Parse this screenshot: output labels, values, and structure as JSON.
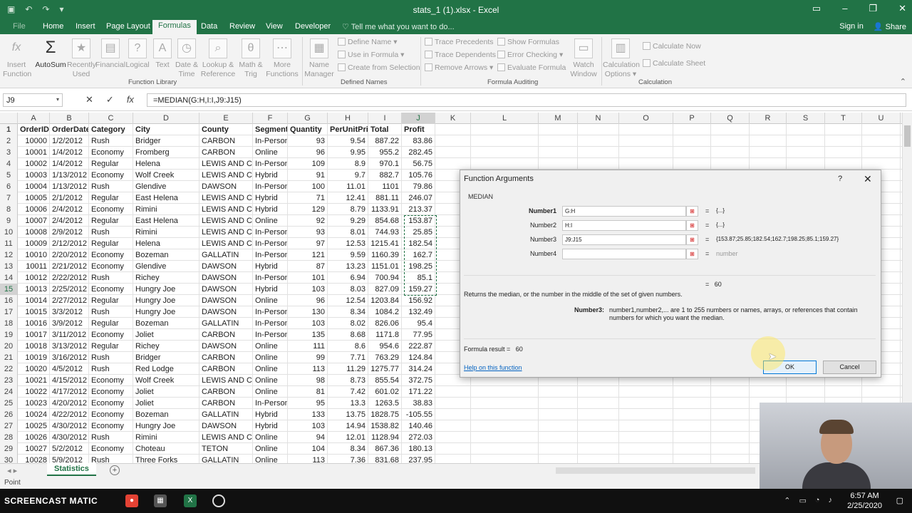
{
  "window": {
    "title": "stats_1 (1).xlsx - Excel"
  },
  "tabs": [
    "Home",
    "Insert",
    "Page Layout",
    "Formulas",
    "Data",
    "Review",
    "View",
    "Developer"
  ],
  "active_tab": "Formulas",
  "tell_me": "Tell me what you want to do...",
  "sign_in": "Sign in",
  "share": "Share",
  "ribbon": {
    "insert_function": [
      "Insert",
      "Function"
    ],
    "autosum": "AutoSum",
    "recently_used": [
      "Recently",
      "Used"
    ],
    "financial": "Financial",
    "logical": "Logical",
    "text": "Text",
    "date_time": [
      "Date &",
      "Time"
    ],
    "lookup": [
      "Lookup &",
      "Reference"
    ],
    "math": [
      "Math &",
      "Trig"
    ],
    "more": [
      "More",
      "Functions"
    ],
    "name_manager": [
      "Name",
      "Manager"
    ],
    "define_name": "Define Name",
    "use_in_formula": "Use in Formula",
    "create_from_selection": "Create from Selection",
    "trace_precedents": "Trace Precedents",
    "trace_dependents": "Trace Dependents",
    "remove_arrows": "Remove Arrows",
    "show_formulas": "Show Formulas",
    "error_checking": "Error Checking",
    "evaluate_formula": "Evaluate Formula",
    "watch_window": [
      "Watch",
      "Window"
    ],
    "calc_options": [
      "Calculation",
      "Options"
    ],
    "calc_now": "Calculate Now",
    "calc_sheet": "Calculate Sheet",
    "groups": [
      "Function Library",
      "Defined Names",
      "Formula Auditing",
      "Calculation"
    ]
  },
  "formula_bar": {
    "name_box": "J9",
    "formula": "=MEDIAN(G:H,I:I,J9:J15)",
    "fx": "fx"
  },
  "columns": [
    "A",
    "B",
    "C",
    "D",
    "E",
    "F",
    "G",
    "H",
    "I",
    "J",
    "K",
    "L",
    "M",
    "N",
    "O",
    "P",
    "Q",
    "R",
    "S",
    "T",
    "U"
  ],
  "headers": [
    "OrderID",
    "OrderDate",
    "Category",
    "City",
    "County",
    "Segment",
    "Quantity",
    "PerUnitPrice",
    "Total",
    "Profit"
  ],
  "rows": [
    [
      "10000",
      "1/2/2012",
      "Rush",
      "Bridger",
      "CARBON",
      "In-Person",
      "93",
      "9.54",
      "887.22",
      "83.86"
    ],
    [
      "10001",
      "1/4/2012",
      "Economy",
      "Fromberg",
      "CARBON",
      "Online",
      "96",
      "9.95",
      "955.2",
      "282.45"
    ],
    [
      "10002",
      "1/4/2012",
      "Regular",
      "Helena",
      "LEWIS AND CLARK",
      "In-Person",
      "109",
      "8.9",
      "970.1",
      "56.75"
    ],
    [
      "10003",
      "1/13/2012",
      "Economy",
      "Wolf Creek",
      "LEWIS AND CLARK",
      "Hybrid",
      "91",
      "9.7",
      "882.7",
      "105.76"
    ],
    [
      "10004",
      "1/13/2012",
      "Rush",
      "Glendive",
      "DAWSON",
      "In-Person",
      "100",
      "11.01",
      "1101",
      "79.86"
    ],
    [
      "10005",
      "2/1/2012",
      "Regular",
      "East Helena",
      "LEWIS AND CLARK",
      "Hybrid",
      "71",
      "12.41",
      "881.11",
      "246.07"
    ],
    [
      "10006",
      "2/4/2012",
      "Economy",
      "Rimini",
      "LEWIS AND CLARK",
      "Hybrid",
      "129",
      "8.79",
      "1133.91",
      "213.37"
    ],
    [
      "10007",
      "2/4/2012",
      "Regular",
      "East Helena",
      "LEWIS AND CLARK",
      "Online",
      "92",
      "9.29",
      "854.68",
      "153.87"
    ],
    [
      "10008",
      "2/9/2012",
      "Rush",
      "Rimini",
      "LEWIS AND CLARK",
      "In-Person",
      "93",
      "8.01",
      "744.93",
      "25.85"
    ],
    [
      "10009",
      "2/12/2012",
      "Regular",
      "Helena",
      "LEWIS AND CLARK",
      "In-Person",
      "97",
      "12.53",
      "1215.41",
      "182.54"
    ],
    [
      "10010",
      "2/20/2012",
      "Economy",
      "Bozeman",
      "GALLATIN",
      "In-Person",
      "121",
      "9.59",
      "1160.39",
      "162.7"
    ],
    [
      "10011",
      "2/21/2012",
      "Economy",
      "Glendive",
      "DAWSON",
      "Hybrid",
      "87",
      "13.23",
      "1151.01",
      "198.25"
    ],
    [
      "10012",
      "2/22/2012",
      "Rush",
      "Richey",
      "DAWSON",
      "In-Person",
      "101",
      "6.94",
      "700.94",
      "85.1"
    ],
    [
      "10013",
      "2/25/2012",
      "Economy",
      "Hungry Joe",
      "DAWSON",
      "Hybrid",
      "103",
      "8.03",
      "827.09",
      "159.27"
    ],
    [
      "10014",
      "2/27/2012",
      "Regular",
      "Hungry Joe",
      "DAWSON",
      "Online",
      "96",
      "12.54",
      "1203.84",
      "156.92"
    ],
    [
      "10015",
      "3/3/2012",
      "Rush",
      "Hungry Joe",
      "DAWSON",
      "In-Person",
      "130",
      "8.34",
      "1084.2",
      "132.49"
    ],
    [
      "10016",
      "3/9/2012",
      "Regular",
      "Bozeman",
      "GALLATIN",
      "In-Person",
      "103",
      "8.02",
      "826.06",
      "95.4"
    ],
    [
      "10017",
      "3/11/2012",
      "Economy",
      "Joliet",
      "CARBON",
      "In-Person",
      "135",
      "8.68",
      "1171.8",
      "77.95"
    ],
    [
      "10018",
      "3/13/2012",
      "Regular",
      "Richey",
      "DAWSON",
      "Online",
      "111",
      "8.6",
      "954.6",
      "222.87"
    ],
    [
      "10019",
      "3/16/2012",
      "Rush",
      "Bridger",
      "CARBON",
      "Online",
      "99",
      "7.71",
      "763.29",
      "124.84"
    ],
    [
      "10020",
      "4/5/2012",
      "Rush",
      "Red Lodge",
      "CARBON",
      "Online",
      "113",
      "11.29",
      "1275.77",
      "314.24"
    ],
    [
      "10021",
      "4/15/2012",
      "Economy",
      "Wolf Creek",
      "LEWIS AND CLARK",
      "Online",
      "98",
      "8.73",
      "855.54",
      "372.75"
    ],
    [
      "10022",
      "4/17/2012",
      "Economy",
      "Joliet",
      "CARBON",
      "Online",
      "81",
      "7.42",
      "601.02",
      "171.22"
    ],
    [
      "10023",
      "4/20/2012",
      "Economy",
      "Joliet",
      "CARBON",
      "In-Person",
      "95",
      "13.3",
      "1263.5",
      "38.83"
    ],
    [
      "10024",
      "4/22/2012",
      "Economy",
      "Bozeman",
      "GALLATIN",
      "Hybrid",
      "133",
      "13.75",
      "1828.75",
      "-105.55"
    ],
    [
      "10025",
      "4/30/2012",
      "Economy",
      "Hungry Joe",
      "DAWSON",
      "Hybrid",
      "103",
      "14.94",
      "1538.82",
      "140.46"
    ],
    [
      "10026",
      "4/30/2012",
      "Rush",
      "Rimini",
      "LEWIS AND CLARK",
      "Online",
      "94",
      "12.01",
      "1128.94",
      "272.03"
    ],
    [
      "10027",
      "5/2/2012",
      "Economy",
      "Choteau",
      "TETON",
      "Online",
      "104",
      "8.34",
      "867.36",
      "180.13"
    ],
    [
      "10028",
      "5/9/2012",
      "Rush",
      "Three Forks",
      "GALLATIN",
      "Online",
      "113",
      "7.36",
      "831.68",
      "237.95"
    ]
  ],
  "sheet_tab": "Statistics",
  "status": "Point",
  "dialog": {
    "title": "Function Arguments",
    "help_q": "?",
    "close": "✕",
    "function": "MEDIAN",
    "args": [
      {
        "label": "Number1",
        "value": "G:H",
        "result": "{...}"
      },
      {
        "label": "Number2",
        "value": "H:I",
        "result": "{...}"
      },
      {
        "label": "Number3",
        "value": "J9:J15",
        "result": "{153.87;25.85;182.54;162.7;198.25;85.1;159.27}"
      },
      {
        "label": "Number4",
        "value": "",
        "result": "number"
      }
    ],
    "eq_sign": "=",
    "eq_result": "60",
    "description": "Returns the median, or the number in the middle of the set of given numbers.",
    "arg_name": "Number3:",
    "arg_desc": "number1,number2,... are 1 to 255 numbers or names, arrays, or references that contain numbers for which you want the median.",
    "formula_result_label": "Formula result =",
    "formula_result": "60",
    "help_link": "Help on this function",
    "ok": "OK",
    "cancel": "Cancel"
  },
  "taskbar": {
    "brand": "SCREENCAST  MATIC",
    "time": "6:57 AM",
    "date": "2/25/2020"
  },
  "colors": {
    "excel_green": "#217346",
    "accent": "#0078d7"
  }
}
